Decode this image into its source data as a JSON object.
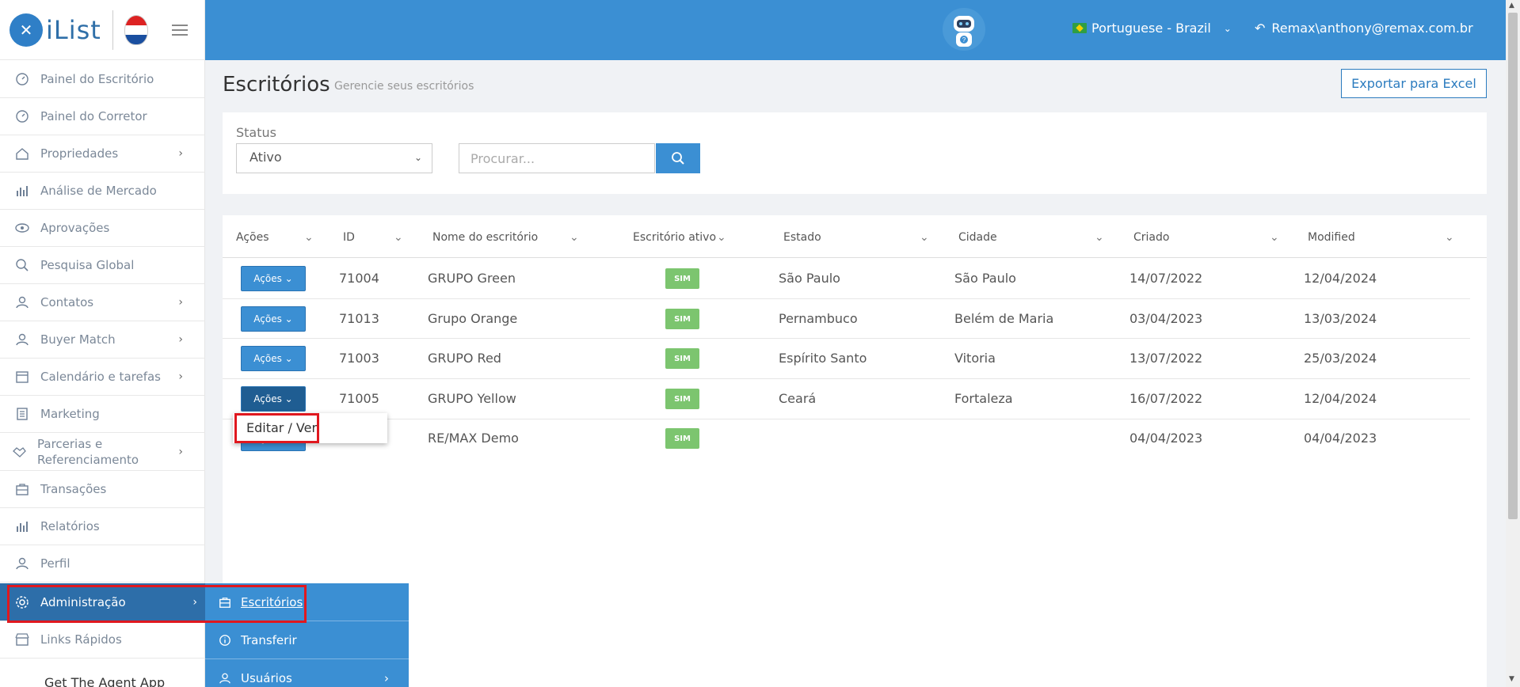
{
  "header": {
    "language": "Portuguese - Brazil",
    "user": "Remax\\anthony@remax.com.br"
  },
  "logo": {
    "text": "iList"
  },
  "sidebar": {
    "items": [
      {
        "label": "Painel do Escritório",
        "icon": "gauge-icon"
      },
      {
        "label": "Painel do Corretor",
        "icon": "gauge-icon"
      },
      {
        "label": "Propriedades",
        "icon": "home-icon",
        "has_children": true
      },
      {
        "label": "Análise de Mercado",
        "icon": "bar-chart-icon"
      },
      {
        "label": "Aprovações",
        "icon": "eye-icon"
      },
      {
        "label": "Pesquisa Global",
        "icon": "search-icon"
      },
      {
        "label": "Contatos",
        "icon": "contacts-icon",
        "has_children": true
      },
      {
        "label": "Buyer Match",
        "icon": "user-icon",
        "has_children": true
      },
      {
        "label": "Calendário e tarefas",
        "icon": "calendar-icon",
        "has_children": true
      },
      {
        "label": "Marketing",
        "icon": "book-icon"
      },
      {
        "label": "Parcerias e Referenciamento",
        "icon": "handshake-icon",
        "has_children": true
      },
      {
        "label": "Transações",
        "icon": "briefcase-icon"
      },
      {
        "label": "Relatórios",
        "icon": "bar-chart-icon"
      },
      {
        "label": "Perfil",
        "icon": "user-icon"
      },
      {
        "label": "Administração",
        "icon": "gear-icon",
        "has_children": true,
        "active": true
      },
      {
        "label": "Links Rápidos",
        "icon": "store-icon"
      }
    ],
    "get_app": "Get The Agent App"
  },
  "submenu": {
    "items": [
      {
        "label": "Escritórios",
        "icon": "briefcase-icon"
      },
      {
        "label": "Transferir",
        "icon": "info-icon"
      },
      {
        "label": "Usuários",
        "icon": "users-icon"
      }
    ]
  },
  "page": {
    "title": "Escritórios",
    "subtitle": "Gerencie seus escritórios",
    "export_label": "Exportar para Excel"
  },
  "filters": {
    "status_label": "Status",
    "status_value": "Ativo",
    "search_placeholder": "Procurar..."
  },
  "table": {
    "columns": [
      "Ações",
      "ID",
      "Nome do escritório",
      "Escritório ativo",
      "Estado",
      "Cidade",
      "Criado",
      "Modified"
    ],
    "action_label": "Ações",
    "active_badge": "SIM",
    "rows": [
      {
        "id": "71004",
        "name": "GRUPO Green",
        "active": "SIM",
        "state": "São Paulo",
        "city": "São Paulo",
        "created": "14/07/2022",
        "modified": "12/04/2024"
      },
      {
        "id": "71013",
        "name": "Grupo Orange",
        "active": "SIM",
        "state": "Pernambuco",
        "city": "Belém de Maria",
        "created": "03/04/2023",
        "modified": "13/03/2024"
      },
      {
        "id": "71003",
        "name": "GRUPO Red",
        "active": "SIM",
        "state": "Espírito Santo",
        "city": "Vitoria",
        "created": "13/07/2022",
        "modified": "25/03/2024"
      },
      {
        "id": "71005",
        "name": "GRUPO Yellow",
        "active": "SIM",
        "state": "Ceará",
        "city": "Fortaleza",
        "created": "16/07/2022",
        "modified": "12/04/2024"
      },
      {
        "id": "",
        "name": "RE/MAX Demo",
        "active": "SIM",
        "state": "",
        "city": "",
        "created": "04/04/2023",
        "modified": "04/04/2023"
      }
    ]
  },
  "dropdown": {
    "item": "Editar / Ver"
  },
  "colors": {
    "primary": "#3b8fd3",
    "active_nav": "#2d6ea9",
    "badge": "#7cc56f",
    "highlight": "#e0181f"
  }
}
